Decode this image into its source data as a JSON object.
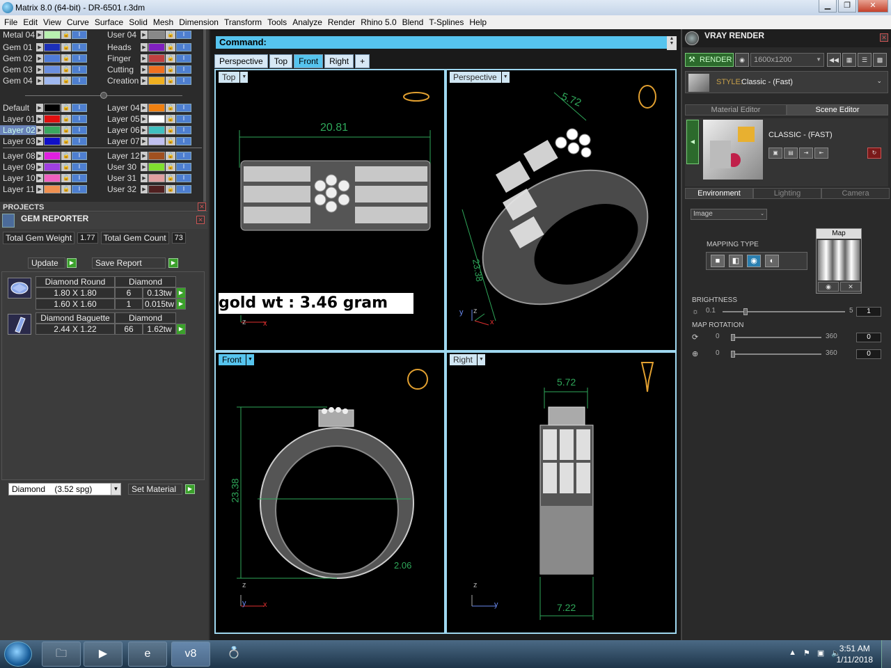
{
  "window": {
    "title": "Matrix 8.0 (64-bit) - DR-6501 r.3dm",
    "min": "▁",
    "max": "❐",
    "close": "✕"
  },
  "menu": [
    "File",
    "Edit",
    "View",
    "Curve",
    "Surface",
    "Solid",
    "Mesh",
    "Dimension",
    "Transform",
    "Tools",
    "Analyze",
    "Render",
    "Rhino 5.0",
    "Blend",
    "T-Splines",
    "Help"
  ],
  "layers": {
    "left": [
      {
        "name": "Metal 04",
        "color": "#b9f0b0"
      },
      {
        "name": "Gem 01",
        "color": "#1c2fb8"
      },
      {
        "name": "Gem 02",
        "color": "#4f7bd8"
      },
      {
        "name": "Gem 03",
        "color": "#6b8fe0"
      },
      {
        "name": "Gem 04",
        "color": "#9fb8f0"
      },
      {
        "name": "Default",
        "color": "#000000"
      },
      {
        "name": "Layer 01",
        "color": "#e01010"
      },
      {
        "name": "Layer 02",
        "color": "#3aa860"
      },
      {
        "name": "Layer 03",
        "color": "#1010c8"
      },
      {
        "name": "Layer 08",
        "color": "#e020e0"
      },
      {
        "name": "Layer 09",
        "color": "#a040e0"
      },
      {
        "name": "Layer 10",
        "color": "#f060c0"
      },
      {
        "name": "Layer 11",
        "color": "#f09050"
      }
    ],
    "right": [
      {
        "name": "User 04",
        "color": "#888888"
      },
      {
        "name": "Heads",
        "color": "#8020c0"
      },
      {
        "name": "Finger",
        "color": "#c04040"
      },
      {
        "name": "Cutting",
        "color": "#f07020"
      },
      {
        "name": "Creation",
        "color": "#f0b020"
      },
      {
        "name": "Layer 04",
        "color": "#f08010"
      },
      {
        "name": "Layer 05",
        "color": "#ffffff"
      },
      {
        "name": "Layer 06",
        "color": "#40c0c0"
      },
      {
        "name": "Layer 07",
        "color": "#c0c0f0"
      },
      {
        "name": "Layer 12",
        "color": "#a05020"
      },
      {
        "name": "User 30",
        "color": "#80e030"
      },
      {
        "name": "User 31",
        "color": "#e0a0a0"
      },
      {
        "name": "User 32",
        "color": "#502020"
      }
    ]
  },
  "projects": {
    "title": "PROJECTS"
  },
  "gem_reporter": {
    "title": "GEM REPORTER",
    "total_weight_label": "Total Gem Weight",
    "total_weight": "1.77",
    "total_count_label": "Total Gem Count",
    "total_count": "73",
    "update_label": "Update",
    "save_label": "Save Report",
    "groups": [
      {
        "shape": "Diamond Round",
        "material": "Diamond",
        "rows": [
          {
            "size": "1.80 X 1.80",
            "count": "6",
            "weight": "0.13tw"
          },
          {
            "size": "1.60 X 1.60",
            "count": "1",
            "weight": "0.015tw"
          }
        ]
      },
      {
        "shape": "Diamond Baguette",
        "material": "Diamond",
        "rows": [
          {
            "size": "2.44 X 1.22",
            "count": "66",
            "weight": "1.62tw"
          }
        ]
      }
    ],
    "material_select": "Diamond    (3.52 spg)",
    "set_material_label": "Set Material"
  },
  "command": {
    "label": "Command:"
  },
  "view_tabs": [
    "Perspective",
    "Top",
    "Front",
    "Right",
    "+"
  ],
  "active_view_tab": "Front",
  "viewports": {
    "top": {
      "label": "Top",
      "dim": "20.81"
    },
    "perspective": {
      "label": "Perspective",
      "dim_a": "5.72",
      "dim_b": "23.38"
    },
    "front": {
      "label": "Front",
      "dim_a": "23.38",
      "dim_b": "2.06"
    },
    "right": {
      "label": "Right",
      "dim_a": "5.72",
      "dim_b": "7.22"
    },
    "axis_x": "x",
    "axis_y": "y",
    "axis_z": "z"
  },
  "gold_weight_note": "gold wt : 3.46 gram",
  "vray": {
    "title": "VRAY RENDER",
    "render_label": "RENDER",
    "resolution": "1600x1200",
    "style_label": "STYLE:",
    "style_value": "Classic - (Fast)",
    "tabs": [
      "Material Editor",
      "Scene Editor"
    ],
    "active_tab": "Scene Editor",
    "scene_name": "CLASSIC - (FAST)",
    "env_tabs": [
      "Environment",
      "Lighting",
      "Camera"
    ],
    "active_env_tab": "Environment",
    "env_select": "Image",
    "mapping_type_label": "MAPPING TYPE",
    "map_label": "Map",
    "brightness_label": "BRIGHTNESS",
    "brightness": {
      "min": "0.1",
      "max": "5",
      "value": "1"
    },
    "map_rotation_label": "MAP ROTATION",
    "rotation_h": {
      "min": "0",
      "max": "360",
      "value": "0"
    },
    "rotation_v": {
      "min": "0",
      "max": "360",
      "value": "0"
    }
  },
  "taskbar": {
    "time": "3:51 AM",
    "date": "1/11/2018"
  },
  "colors": {
    "accent": "#56c4ee",
    "green_button": "#3ba12b",
    "dim_line": "#2fa85a"
  }
}
